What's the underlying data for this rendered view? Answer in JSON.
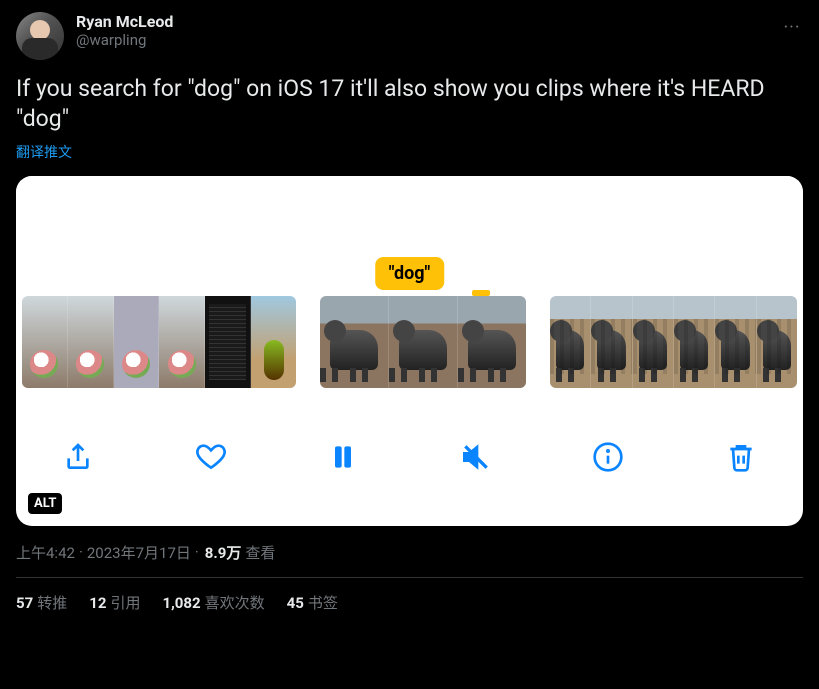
{
  "author": {
    "display_name": "Ryan McLeod",
    "handle": "@warpling"
  },
  "tweet_text": "If you search for \"dog\" on iOS 17 it'll also show you clips where it's HEARD \"dog\"",
  "translate_label": "翻译推文",
  "media": {
    "tag_label": "\"dog\"",
    "alt_badge": "ALT",
    "toolbar": {
      "share": "share",
      "like": "like",
      "pause": "pause",
      "mute": "mute",
      "info": "info",
      "trash": "trash"
    }
  },
  "meta": {
    "time": "上午4:42",
    "date": "2023年7月17日",
    "views_count": "8.9万",
    "views_label": "查看"
  },
  "stats": {
    "retweets": {
      "count": "57",
      "label": "转推"
    },
    "quotes": {
      "count": "12",
      "label": "引用"
    },
    "likes": {
      "count": "1,082",
      "label": "喜欢次数"
    },
    "bookmarks": {
      "count": "45",
      "label": "书签"
    }
  },
  "more_icon": "···"
}
